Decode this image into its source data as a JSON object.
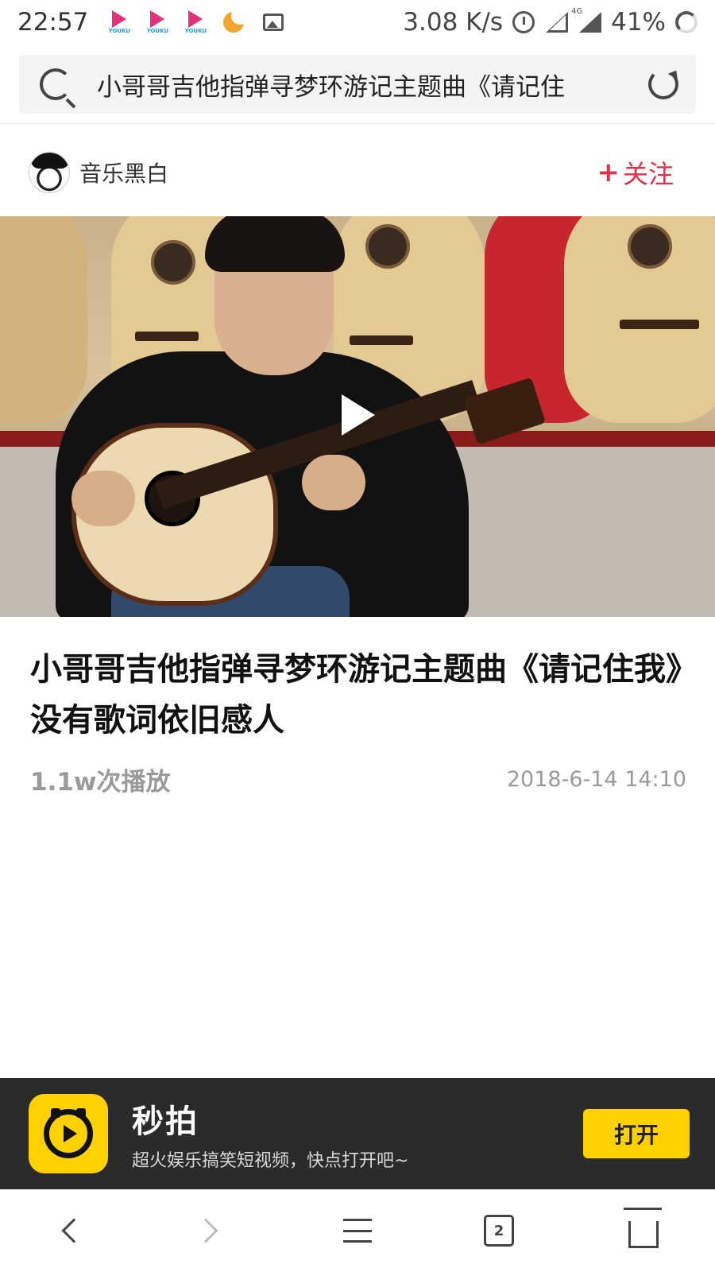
{
  "status_bar": {
    "time": "22:57",
    "notification_icons": [
      {
        "name": "youku-icon",
        "label": "YOUKU"
      },
      {
        "name": "youku-icon",
        "label": "YOUKU"
      },
      {
        "name": "youku-icon",
        "label": "YOUKU"
      },
      {
        "name": "moon-icon"
      },
      {
        "name": "gallery-icon"
      }
    ],
    "network_speed": "3.08 K/s",
    "network_type": "4G",
    "battery": "41%"
  },
  "search": {
    "query": "小哥哥吉他指弹寻梦环游记主题曲《请记住"
  },
  "author": {
    "name": "音乐黑白",
    "follow_label": "关注",
    "follow_plus": "+",
    "follow_color": "#e0304a"
  },
  "video": {
    "title": "小哥哥吉他指弹寻梦环游记主题曲《请记住我》没有歌词依旧感人",
    "play_count": "1.1w次播放",
    "publish_time": "2018-6-14 14:10"
  },
  "app_banner": {
    "app_name": "秒拍",
    "slogan": "超火娱乐搞笑短视频，快点打开吧~",
    "open_label": "打开",
    "accent_color": "#ffd100"
  },
  "bottom_nav": {
    "tab_count": "2"
  }
}
